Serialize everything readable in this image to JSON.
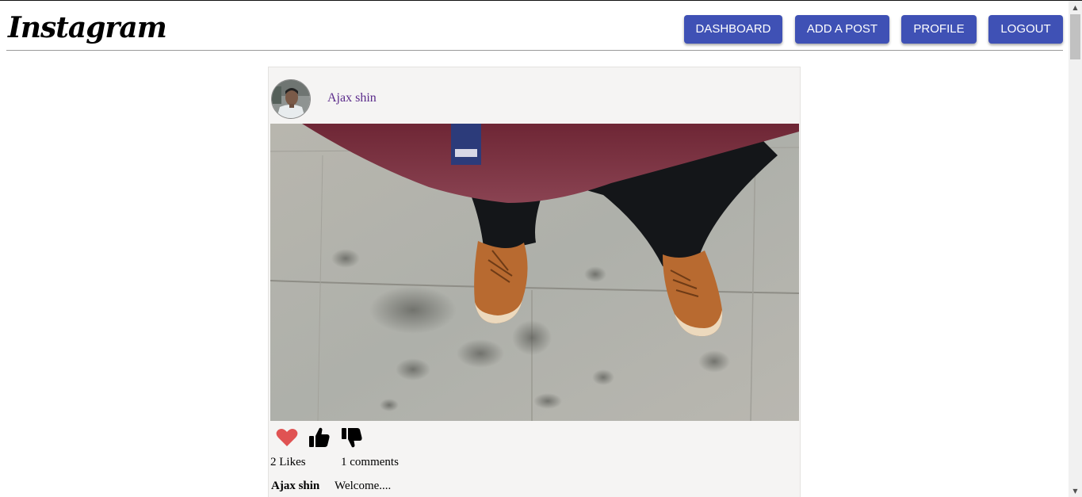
{
  "header": {
    "logo_text": "Instagram",
    "nav": {
      "dashboard": "DASHBOARD",
      "add_post": "ADD A POST",
      "profile": "PROFILE",
      "logout": "LOGOUT"
    },
    "accent_color": "#3f51b5"
  },
  "post": {
    "author": "Ajax shin",
    "image_icon": "post-photo",
    "actions": {
      "love_icon": "heart-icon",
      "like_icon": "thumbs-up-icon",
      "dislike_icon": "thumbs-down-icon"
    },
    "likes_text": "2 Likes",
    "comments_text": "1 comments",
    "caption_author": "Ajax shin",
    "caption_text": "Welcome...."
  }
}
